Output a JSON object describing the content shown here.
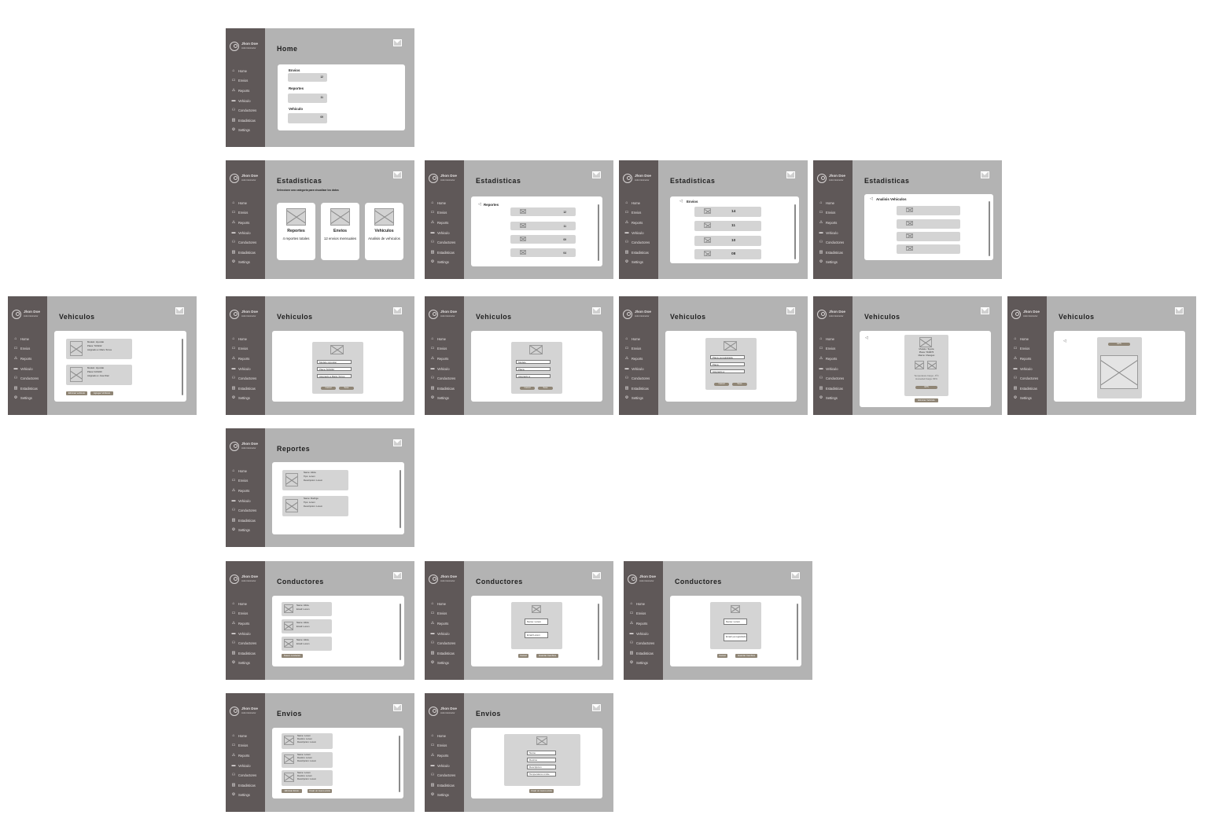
{
  "user": {
    "name": "Jhon Doe",
    "role": "Administrador"
  },
  "nav": {
    "items": [
      {
        "icon": "⌂",
        "label": "Home"
      },
      {
        "icon": "▭",
        "label": "Envios"
      },
      {
        "icon": "⚠",
        "label": "Reports"
      },
      {
        "icon": "▬",
        "label": "Vehiculo"
      },
      {
        "icon": "⚇",
        "label": "Conductores"
      },
      {
        "icon": "▥",
        "label": "Estadisticas"
      }
    ],
    "settings": "Settings"
  },
  "colors": {
    "sidebar": "#5f5858",
    "frame": "#b3b3b3",
    "accent_button": "#8f8575"
  },
  "home": {
    "title": "Home",
    "sections": [
      {
        "label": "Envios",
        "value": "12"
      },
      {
        "label": "Reportes",
        "value": "11"
      },
      {
        "label": "Vehiculo",
        "value": "09"
      }
    ]
  },
  "estadisticas": {
    "title": "Estadisticas",
    "subtitle": "Seleccione una categoria para visualizar los datos",
    "cards": [
      {
        "title": "Reportes",
        "desc": "4 reportes totales"
      },
      {
        "title": "Envios",
        "desc": "12 envios mensuales"
      },
      {
        "title": "Vehiculos",
        "desc": "Analisis de vehiculos"
      }
    ],
    "reportes_title": "Reportes",
    "reportes_values": [
      "12",
      "11",
      "09",
      "04"
    ],
    "envios_title": "Envios",
    "envios_values": [
      "14",
      "11",
      "10",
      "08"
    ],
    "analisis_title": "Analisis Vehiculos"
  },
  "vehiculos": {
    "title": "Vehiculos",
    "list": [
      {
        "l1": "Modelo: Hyundai",
        "l2": "Placa: TAS342",
        "l3": "Asignado a: Mario Torres"
      },
      {
        "l1": "Modelo: Hyundai",
        "l2": "Placa: FAS340",
        "l3": "Asignado a: Jose Diaz"
      }
    ],
    "list_buttons": [
      "Eliminar vehiculo",
      "Agregar Vehiculo"
    ],
    "form_fields": [
      "Modelo Hyundai",
      "Placa TAS342",
      "Asignado a Mario Torres"
    ],
    "form_fields_2": [
      "Modelo",
      "Placa",
      "Asignado a"
    ],
    "form_buttons": [
      "Cancel",
      "Save"
    ],
    "form_fields_3": [
      "Placa ya registrada",
      "Placa",
      "Asignado a"
    ],
    "detail": [
      "Modelo: Toyota",
      "Placa: TAS876",
      "Marca: Changan"
    ],
    "detail_stats": [
      "Temperatura Carga: -6ºC",
      "Humedad Carga: 83%"
    ],
    "gps_label": "GPS",
    "delete_label": "Eliminar Vehiculo"
  },
  "reportes": {
    "title": "Reportes",
    "list": [
      {
        "l1": "Name: Alicia",
        "l2": "Tipo: Lorem",
        "l3": "Descripcion: Lorem"
      },
      {
        "l1": "Name: Rodrigo",
        "l2": "Tipo: Lorem",
        "l3": "Descripcion: Lorem"
      }
    ]
  },
  "conductores": {
    "title": "Conductores",
    "list": [
      {
        "l1": "Name: Alicia",
        "l2": "Email: Lorem"
      },
      {
        "l1": "Name: Alicia",
        "l2": "Email: Lorem"
      },
      {
        "l1": "Name: Alicia",
        "l2": "Email: Lorem"
      }
    ],
    "new_button": "Nuevo conductor",
    "form_fields": [
      "Name: Lorem",
      "Email Lorem"
    ],
    "form_fields_err": [
      "Name: Lorem",
      "Email ya registrado"
    ],
    "form_buttons": [
      "Cancel",
      "Guardar Cambios"
    ]
  },
  "envios": {
    "title": "Envios",
    "list": [
      {
        "l1": "Name: Lorem",
        "l2": "Destino: Lorem",
        "l3": "Descripcion: Lorem"
      },
      {
        "l1": "Name: Lorem",
        "l2": "Destino: Lorem",
        "l3": "Descripcion: Lorem"
      },
      {
        "l1": "Name: Lorem",
        "l2": "Destino: Lorem",
        "l3": "Descripcion: Lorem"
      }
    ],
    "list_buttons": [
      "Eliminar Envio",
      "Crear un nuevo envio"
    ],
    "form_fields": [
      "Name",
      "Destino",
      "Descripcion",
      "Temperatura Limite"
    ],
    "form_button": "Crear un nuevo envio"
  }
}
